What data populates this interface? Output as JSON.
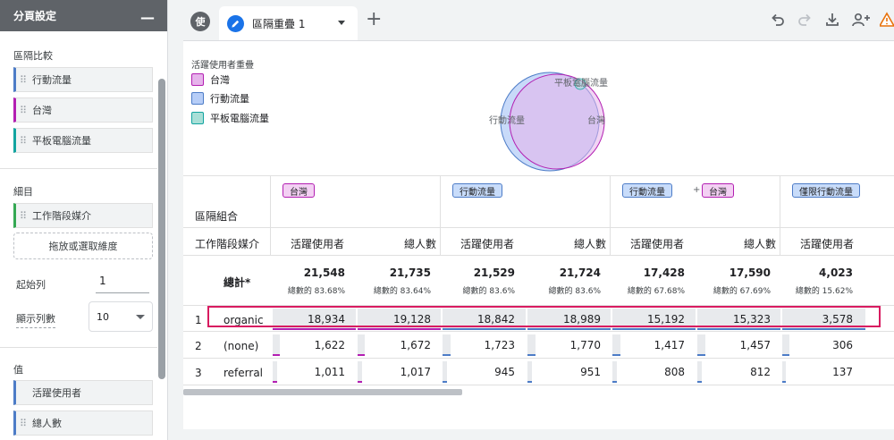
{
  "left_panel": {
    "title": "分頁設定",
    "minimize": "—",
    "segments_title": "區隔比較",
    "segments": [
      {
        "label": "行動流量",
        "color": "#4d7cc7"
      },
      {
        "label": "台灣",
        "color": "#b31fb2"
      },
      {
        "label": "平板電腦流量",
        "color": "#12a4a0"
      }
    ],
    "rows_title": "細目",
    "row_dimension": {
      "label": "工作階段媒介",
      "color": "#34a853"
    },
    "drop_hint": "拖放或選取維度",
    "start_row_label": "起始列",
    "start_row_value": "1",
    "show_rows_label": "顯示列數",
    "show_rows_value": "10",
    "values_title": "值",
    "values": [
      {
        "label": "活躍使用者",
        "color": "#4d7cc7"
      },
      {
        "label": "總人數",
        "color": "#4d7cc7"
      }
    ]
  },
  "topbar": {
    "user_initial": "使",
    "tab_name": "區隔重疊 1",
    "add_tab": "+"
  },
  "venn": {
    "title": "活躍使用者重疊",
    "legend": [
      {
        "label": "台灣",
        "color": "#e6b3eb",
        "border": "#b31fb2"
      },
      {
        "label": "行動流量",
        "color": "#b6cdf7",
        "border": "#4d7cc7"
      },
      {
        "label": "平板電腦流量",
        "color": "#a8dfd7",
        "border": "#12a4a0"
      }
    ],
    "labels": {
      "mobile": "行動流量",
      "taiwan": "台灣",
      "tablet": "平板電腦流量"
    }
  },
  "table": {
    "combo_header": "區隔組合",
    "dim_header": "工作階段媒介",
    "segment_groups": [
      {
        "segments": [
          "台灣"
        ],
        "types": [
          "tw"
        ]
      },
      {
        "segments": [
          "行動流量"
        ],
        "types": [
          "mb"
        ]
      },
      {
        "segments": [
          "行動流量",
          "台灣"
        ],
        "types": [
          "mb",
          "tw"
        ],
        "joiner": "+"
      },
      {
        "segments": [
          "僅限行動流量"
        ],
        "types": [
          "mb"
        ]
      }
    ],
    "metric_headers": [
      "活躍使用者",
      "總人數",
      "活躍使用者",
      "總人數",
      "活躍使用者",
      "總人數",
      "活躍使用者"
    ],
    "totals_label": "總計*",
    "totals": [
      {
        "value": "21,548",
        "pct": "總數的 83.68%"
      },
      {
        "value": "21,735",
        "pct": "總數的 83.64%"
      },
      {
        "value": "21,529",
        "pct": "總數的 83.6%"
      },
      {
        "value": "21,724",
        "pct": "總數的 83.6%"
      },
      {
        "value": "17,428",
        "pct": "總數的 67.68%"
      },
      {
        "value": "17,590",
        "pct": "總數的 67.69%"
      },
      {
        "value": "4,023",
        "pct": "總數的 15.62%"
      }
    ],
    "rows": [
      {
        "index": "1",
        "dim": "organic",
        "values": [
          "18,934",
          "19,128",
          "18,842",
          "18,989",
          "15,192",
          "15,323",
          "3,578"
        ]
      },
      {
        "index": "2",
        "dim": "(none)",
        "values": [
          "1,622",
          "1,672",
          "1,723",
          "1,770",
          "1,417",
          "1,457",
          "306"
        ]
      },
      {
        "index": "3",
        "dim": "referral",
        "values": [
          "1,011",
          "1,017",
          "945",
          "951",
          "808",
          "812",
          "137"
        ]
      }
    ],
    "bar_colors": [
      "#b31fb2",
      "#b31fb2",
      "#4d7cc7",
      "#4d7cc7",
      "#4d7cc7",
      "#4d7cc7",
      "#4d7cc7"
    ]
  }
}
